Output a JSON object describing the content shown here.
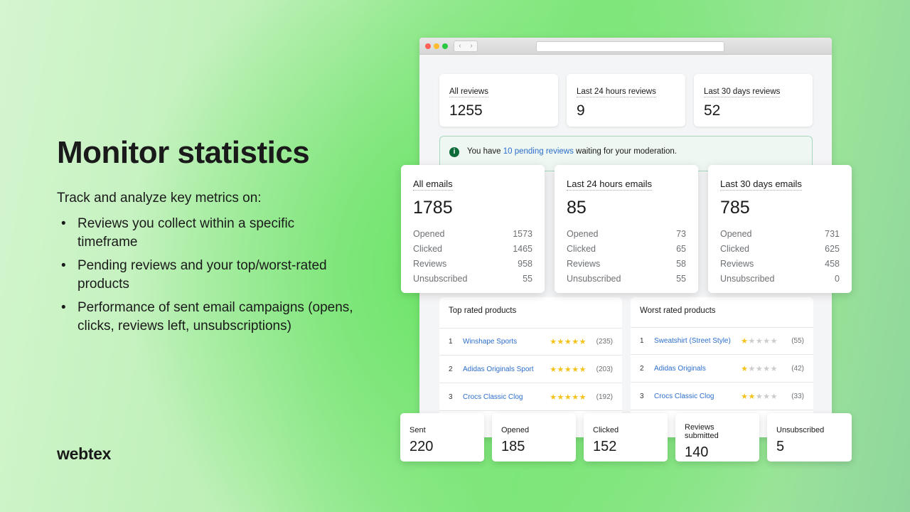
{
  "hero": {
    "title": "Monitor statistics",
    "intro": "Track and analyze key metrics on:",
    "bullets": [
      "Reviews you collect within a specific timeframe",
      "Pending reviews and your top/worst-rated products",
      "Performance of sent email campaigns (opens, clicks, reviews left, unsubscriptions)"
    ]
  },
  "logo": "webtex",
  "browser": {
    "back": "‹",
    "forward": "›"
  },
  "reviews": [
    {
      "label": "All reviews",
      "value": "1255"
    },
    {
      "label": "Last 24 hours reviews",
      "value": "9"
    },
    {
      "label": "Last 30 days reviews",
      "value": "52"
    }
  ],
  "banner": {
    "prefix": "You have ",
    "link": "10 pending reviews",
    "suffix": " waiting for your moderation.",
    "icon": "info-icon"
  },
  "emails": [
    {
      "label": "All emails",
      "value": "1785",
      "rows": [
        [
          "Opened",
          "1573"
        ],
        [
          "Clicked",
          "1465"
        ],
        [
          "Reviews",
          "958"
        ],
        [
          "Unsubscribed",
          "55"
        ]
      ]
    },
    {
      "label": "Last 24 hours emails",
      "value": "85",
      "rows": [
        [
          "Opened",
          "73"
        ],
        [
          "Clicked",
          "65"
        ],
        [
          "Reviews",
          "58"
        ],
        [
          "Unsubscribed",
          "55"
        ]
      ]
    },
    {
      "label": "Last 30 days emails",
      "value": "785",
      "rows": [
        [
          "Opened",
          "731"
        ],
        [
          "Clicked",
          "625"
        ],
        [
          "Reviews",
          "458"
        ],
        [
          "Unsubscribed",
          "0"
        ]
      ]
    }
  ],
  "top": {
    "title": "Top rated products",
    "items": [
      {
        "rank": "1",
        "name": "Winshape Sports",
        "rating": 5,
        "count": "(235)"
      },
      {
        "rank": "2",
        "name": "Adidas Originals Sport",
        "rating": 5,
        "count": "(203)"
      },
      {
        "rank": "3",
        "name": "Crocs Classic Clog",
        "rating": 5,
        "count": "(192)"
      }
    ]
  },
  "worst": {
    "title": "Worst rated products",
    "items": [
      {
        "rank": "1",
        "name": "Sweatshirt (Street Style)",
        "rating": 1,
        "count": "(55)"
      },
      {
        "rank": "2",
        "name": "Adidas Originals",
        "rating": 1,
        "count": "(42)"
      },
      {
        "rank": "3",
        "name": "Crocs Classic Clog",
        "rating": 2,
        "count": "(33)"
      }
    ]
  },
  "campaign": [
    {
      "label": "Sent",
      "value": "220"
    },
    {
      "label": "Opened",
      "value": "185"
    },
    {
      "label": "Clicked",
      "value": "152"
    },
    {
      "label": "Reviews submitted",
      "value": "140"
    },
    {
      "label": "Unsubscribed",
      "value": "5"
    }
  ],
  "colors": {
    "link": "#2c6ecb",
    "star": "#f5c21b",
    "info": "#0f6b3a"
  }
}
